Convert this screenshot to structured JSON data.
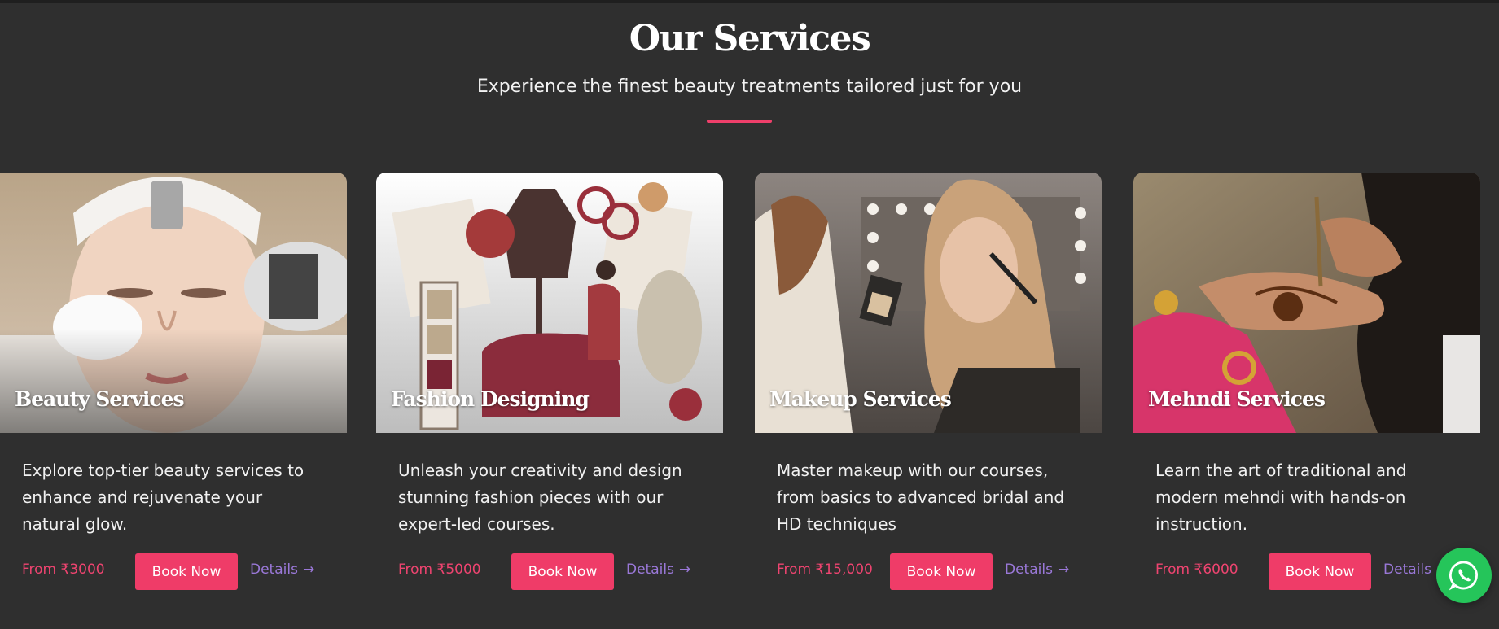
{
  "section": {
    "title": "Our Services",
    "subtitle": "Experience the finest beauty treatments tailored just for you",
    "accent_color": "#ee3f6a"
  },
  "cards": [
    {
      "title": "Beauty Services",
      "description": "Explore top-tier beauty services to enhance and rejuvenate your natural glow.",
      "price": "From ₹3000",
      "book_label": "Book Now",
      "details_label": "Details"
    },
    {
      "title": "Fashion Designing",
      "description": "Unleash your creativity and design stunning fashion pieces with our expert-led courses.",
      "price": "From ₹5000",
      "book_label": "Book Now",
      "details_label": "Details"
    },
    {
      "title": "Makeup Services",
      "description": "Master makeup with our courses, from basics to advanced bridal and HD techniques",
      "price": "From ₹15,000",
      "book_label": "Book Now",
      "details_label": "Details"
    },
    {
      "title": "Mehndi Services",
      "description": "Learn the art of traditional and modern mehndi with hands-on instruction.",
      "price": "From ₹6000",
      "book_label": "Book Now",
      "details_label": "Details"
    }
  ],
  "icons": {
    "details_arrow": "arrow-right-icon",
    "floating_button": "whatsapp-icon"
  },
  "colors": {
    "background": "#2f2f2f",
    "book_button": "#ef3c68",
    "price": "#ee4470",
    "details_link": "#9a78d8",
    "whatsapp": "#25c55a"
  }
}
